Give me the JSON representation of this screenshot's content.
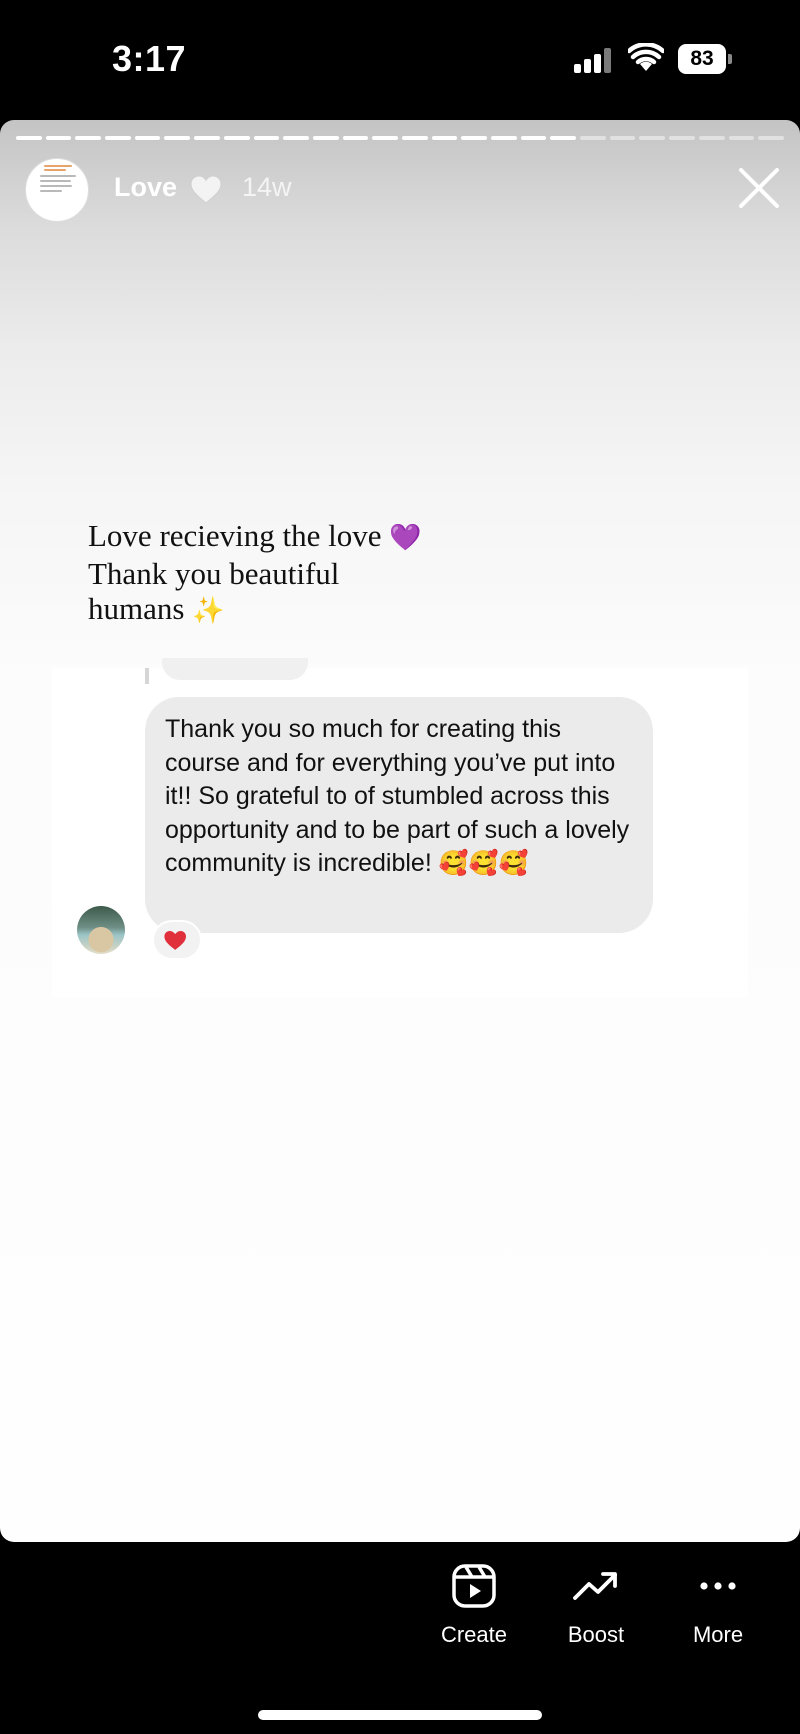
{
  "status_bar": {
    "time": "3:17",
    "battery_level": "83"
  },
  "story": {
    "progress": {
      "segments": 26,
      "completed": 19
    },
    "username": "Love",
    "age": "14w",
    "caption_lines": [
      "Love recieving the love",
      "Thank you beautiful",
      "humans"
    ],
    "caption_emoji": [
      "💜",
      "✨"
    ],
    "message": {
      "text": "Thank you so much for creating this course and for everything you’ve put into it!! So grateful to of stumbled across this opportunity and to be part of such a lovely community is incredible!",
      "emoji": "🥰🥰🥰",
      "reaction": "❤️"
    }
  },
  "bottom_actions": [
    {
      "label": "Create",
      "icon": "reels-create-icon"
    },
    {
      "label": "Boost",
      "icon": "trending-up-icon"
    },
    {
      "label": "More",
      "icon": "more-dots-icon"
    }
  ],
  "colors": {
    "background": "#000000",
    "caption_heart": "#9b3ae0",
    "reaction_heart": "#e0303c"
  }
}
